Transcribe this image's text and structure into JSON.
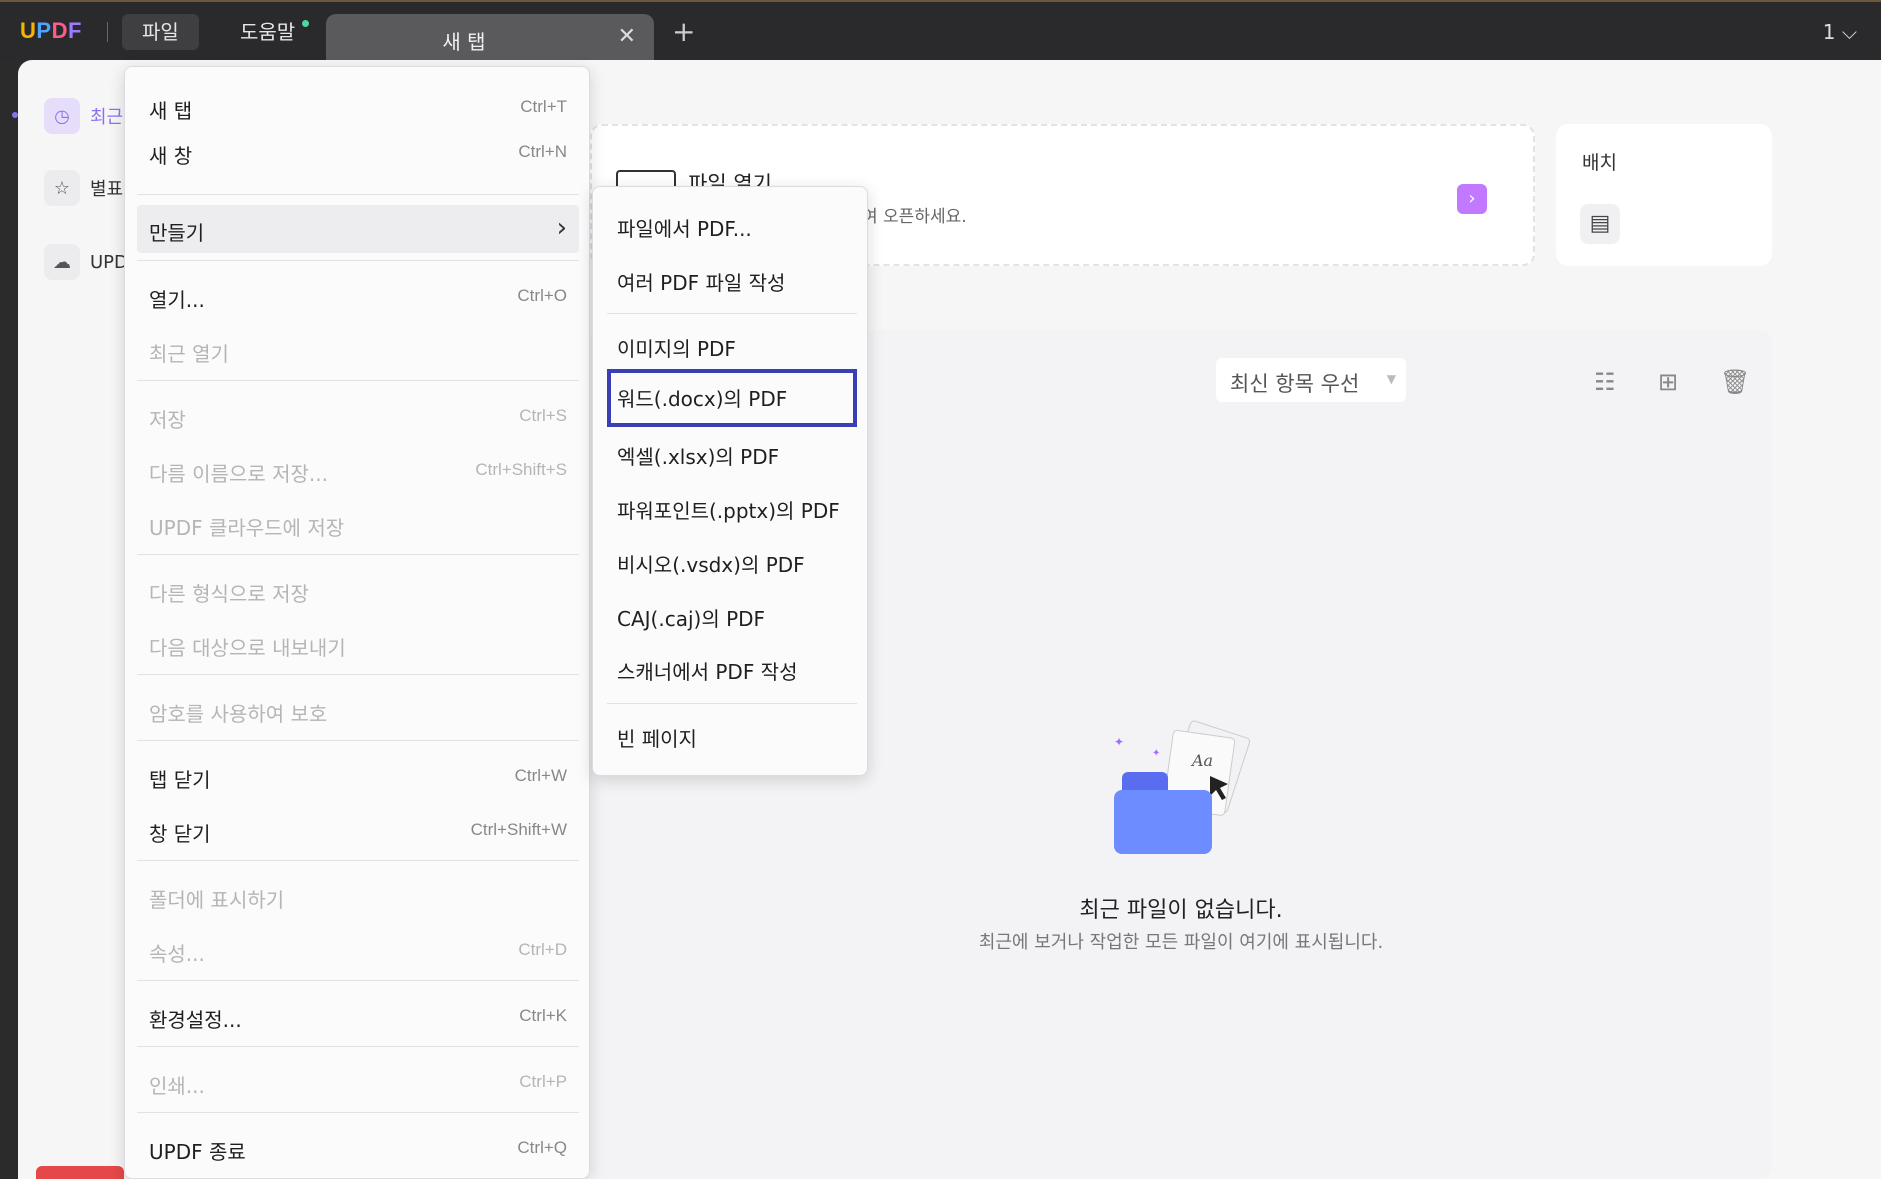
{
  "titlebar": {
    "logo": "UPDF",
    "menu_file": "파일",
    "menu_help": "도움말",
    "tab_label": "새 탭",
    "tab_close": "✕",
    "tab_add": "+",
    "page_counter": "1 ⌵"
  },
  "sidebar": {
    "items": [
      {
        "label": "최근",
        "icon": "clock-icon"
      },
      {
        "label": "별표",
        "icon": "star-icon"
      },
      {
        "label": "UPD",
        "icon": "cloud-icon"
      }
    ]
  },
  "open_card": {
    "title": "파일 열기",
    "subtitle": "여 오픈하세요."
  },
  "batch_card": {
    "title": "배치"
  },
  "recent": {
    "sort_label": "최신 항목 우선",
    "empty_title": "최근 파일이 없습니다.",
    "empty_subtitle": "최근에 보거나 작업한 모든 파일이 여기에 표시됩니다."
  },
  "file_menu": {
    "new_tab": {
      "label": "새 탭",
      "shortcut": "Ctrl+T"
    },
    "new_window": {
      "label": "새 창",
      "shortcut": "Ctrl+N"
    },
    "create": {
      "label": "만들기"
    },
    "open": {
      "label": "열기...",
      "shortcut": "Ctrl+O"
    },
    "open_recent": {
      "label": "최근 열기"
    },
    "save": {
      "label": "저장",
      "shortcut": "Ctrl+S"
    },
    "save_as": {
      "label": "다름 이름으로 저장...",
      "shortcut": "Ctrl+Shift+S"
    },
    "save_cloud": {
      "label": "UPDF 클라우드에 저장"
    },
    "save_other_format": {
      "label": "다른 형식으로 저장"
    },
    "export_to": {
      "label": "다음 대상으로 내보내기"
    },
    "protect_password": {
      "label": "암호를 사용하여 보호"
    },
    "close_tab": {
      "label": "탭 닫기",
      "shortcut": "Ctrl+W"
    },
    "close_window": {
      "label": "창 닫기",
      "shortcut": "Ctrl+Shift+W"
    },
    "show_in_folder": {
      "label": "폴더에 표시하기"
    },
    "properties": {
      "label": "속성...",
      "shortcut": "Ctrl+D"
    },
    "preferences": {
      "label": "환경설정...",
      "shortcut": "Ctrl+K"
    },
    "print": {
      "label": "인쇄...",
      "shortcut": "Ctrl+P"
    },
    "quit": {
      "label": "UPDF 종료",
      "shortcut": "Ctrl+Q"
    }
  },
  "create_submenu": {
    "from_file": "파일에서 PDF...",
    "multiple": "여러 PDF 파일 작성",
    "from_image": "이미지의 PDF",
    "from_word": "워드(.docx)의 PDF",
    "from_excel": "엑셀(.xlsx)의 PDF",
    "from_ppt": "파워포인트(.pptx)의 PDF",
    "from_visio": "비시오(.vsdx)의 PDF",
    "from_caj": "CAJ(.caj)의 PDF",
    "from_scanner": "스캐너에서 PDF 작성",
    "blank_page": "빈 페이지"
  },
  "colors": {
    "accent": "#8f6ff0",
    "focus_border": "#3b3fb6",
    "open_arrow": "#c17aff"
  }
}
